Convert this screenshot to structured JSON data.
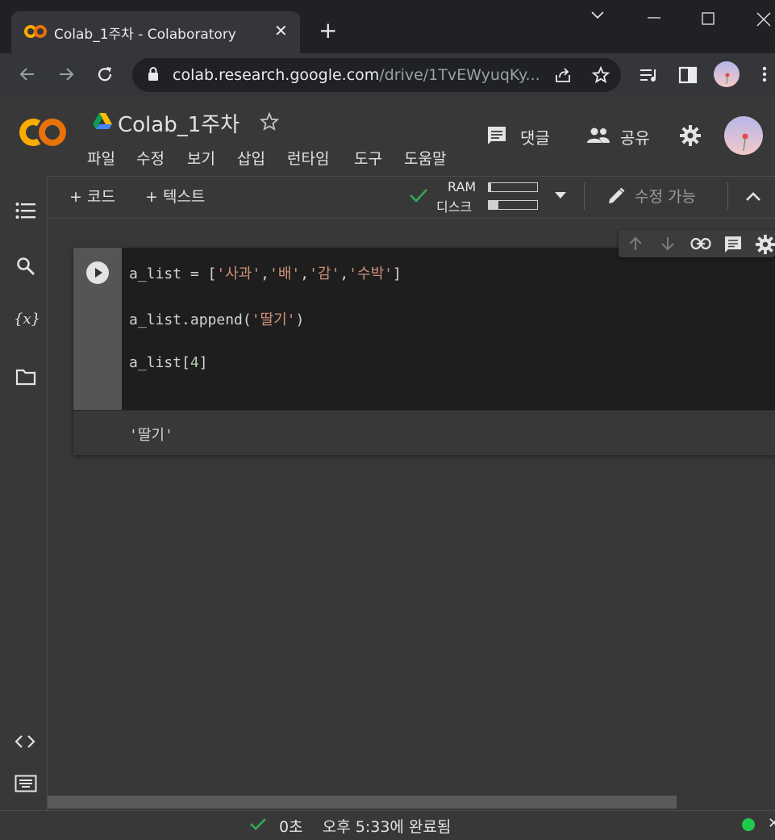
{
  "browser": {
    "tab_title": "Colab_1주차 - Colaboratory",
    "url_host": "colab.research.google.com",
    "url_path": "/drive/1TvEWyuqKy..."
  },
  "colab": {
    "doc_title": "Colab_1주차",
    "comment_label": "댓글",
    "share_label": "공유",
    "menu": [
      "파일",
      "수정",
      "보기",
      "삽입",
      "런타임",
      "도구",
      "도움말"
    ],
    "toolbar": {
      "add_code": "+ 코드",
      "add_text": "+ 텍스트",
      "ram_label": "RAM",
      "disk_label": "디스크",
      "ram_fraction": 0.05,
      "disk_fraction": 0.2,
      "edit_mode": "수정 가능"
    },
    "cell": {
      "line1_a": "a_list = [",
      "line1_s1": "'사과'",
      "line1_c1": ",",
      "line1_s2": "'배'",
      "line1_c2": ",",
      "line1_s3": "'감'",
      "line1_c3": ",",
      "line1_s4": "'수박'",
      "line1_end": "]",
      "line2_a": "a_list.append(",
      "line2_s": "'딸기'",
      "line2_end": ")",
      "line3_a": "a_list[",
      "line3_n": "4",
      "line3_end": "]",
      "output": "'딸기'"
    },
    "status": {
      "duration": "0초",
      "completed": "오후 5:33에 완료됨"
    }
  },
  "colors": {
    "accent_orange": "#f9ab00",
    "status_green": "#34a853",
    "string_color": "#ce9178"
  }
}
